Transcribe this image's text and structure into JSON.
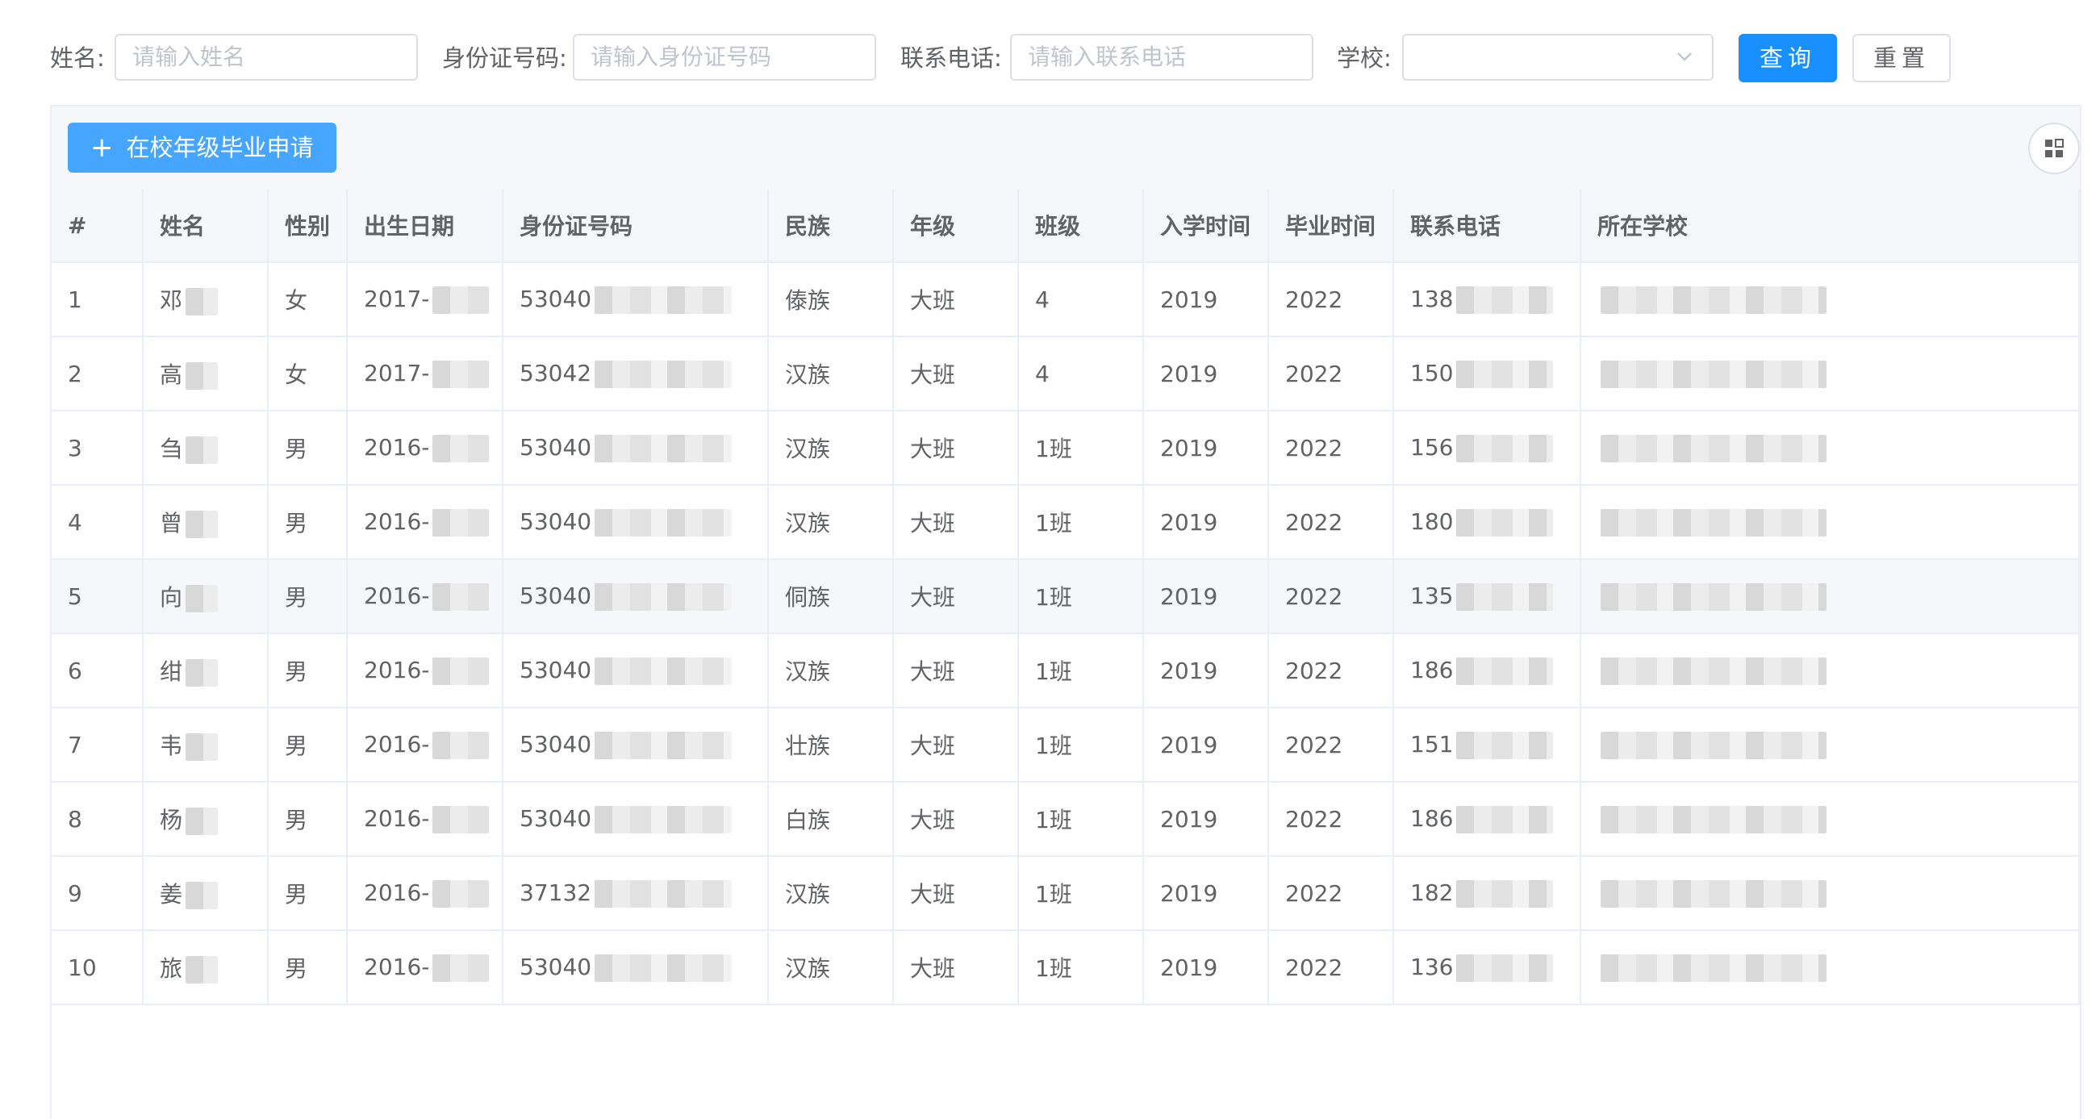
{
  "search": {
    "name_label": "姓名:",
    "name_placeholder": "请输入姓名",
    "id_label": "身份证号码:",
    "id_placeholder": "请输入身份证号码",
    "phone_label": "联系电话:",
    "phone_placeholder": "请输入联系电话",
    "school_label": "学校:",
    "school_value": "",
    "query_button": "查询",
    "reset_button": "重置"
  },
  "toolbar": {
    "apply_button": "在校年级毕业申请",
    "plus_icon": "plus-icon",
    "columns_icon": "grid-icon"
  },
  "table": {
    "headers": [
      "#",
      "姓名",
      "性别",
      "出生日期",
      "身份证号码",
      "民族",
      "年级",
      "班级",
      "入学时间",
      "毕业时间",
      "联系电话",
      "所在学校"
    ],
    "rows": [
      {
        "no": "1",
        "name": "邓",
        "gender": "女",
        "birth": "2017-",
        "id": "53040",
        "ethnic": "傣族",
        "grade": "大班",
        "class": "4",
        "enroll": "2019",
        "graduate": "2022",
        "phone": "138",
        "school": ""
      },
      {
        "no": "2",
        "name": "高",
        "gender": "女",
        "birth": "2017-",
        "id": "53042",
        "ethnic": "汉族",
        "grade": "大班",
        "class": "4",
        "enroll": "2019",
        "graduate": "2022",
        "phone": "150",
        "school": ""
      },
      {
        "no": "3",
        "name": "刍",
        "gender": "男",
        "birth": "2016-",
        "id": "53040",
        "ethnic": "汉族",
        "grade": "大班",
        "class": "1班",
        "enroll": "2019",
        "graduate": "2022",
        "phone": "156",
        "school": ""
      },
      {
        "no": "4",
        "name": "曾",
        "gender": "男",
        "birth": "2016-",
        "id": "53040",
        "ethnic": "汉族",
        "grade": "大班",
        "class": "1班",
        "enroll": "2019",
        "graduate": "2022",
        "phone": "180",
        "school": ""
      },
      {
        "no": "5",
        "name": "向",
        "gender": "男",
        "birth": "2016-",
        "id": "53040",
        "ethnic": "侗族",
        "grade": "大班",
        "class": "1班",
        "enroll": "2019",
        "graduate": "2022",
        "phone": "135",
        "school": ""
      },
      {
        "no": "6",
        "name": "绀",
        "gender": "男",
        "birth": "2016-",
        "id": "53040",
        "ethnic": "汉族",
        "grade": "大班",
        "class": "1班",
        "enroll": "2019",
        "graduate": "2022",
        "phone": "186",
        "school": ""
      },
      {
        "no": "7",
        "name": "韦",
        "gender": "男",
        "birth": "2016-",
        "id": "53040",
        "ethnic": "壮族",
        "grade": "大班",
        "class": "1班",
        "enroll": "2019",
        "graduate": "2022",
        "phone": "151",
        "school": ""
      },
      {
        "no": "8",
        "name": "杨",
        "gender": "男",
        "birth": "2016-",
        "id": "53040",
        "ethnic": "白族",
        "grade": "大班",
        "class": "1班",
        "enroll": "2019",
        "graduate": "2022",
        "phone": "186",
        "school": ""
      },
      {
        "no": "9",
        "name": "姜",
        "gender": "男",
        "birth": "2016-",
        "id": "37132",
        "ethnic": "汉族",
        "grade": "大班",
        "class": "1班",
        "enroll": "2019",
        "graduate": "2022",
        "phone": "182",
        "school": ""
      },
      {
        "no": "10",
        "name": "旅",
        "gender": "男",
        "birth": "2016-",
        "id": "53040",
        "ethnic": "汉族",
        "grade": "大班",
        "class": "1班",
        "enroll": "2019",
        "graduate": "2022",
        "phone": "136",
        "school": ""
      }
    ]
  },
  "colors": {
    "primary": "#1890ff",
    "apply": "#46a6ff",
    "border": "#dcdfe6",
    "header_bg": "#f5f7fa"
  }
}
